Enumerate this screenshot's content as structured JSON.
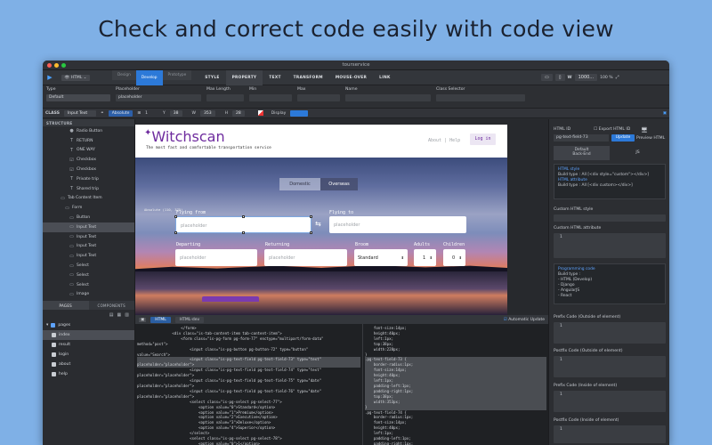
{
  "headline": "Check and correct code easily with code view",
  "window": {
    "title": "tourservice",
    "colors": {
      "close": "#fe5f57",
      "minimize": "#febc2e",
      "zoom": "#28c840",
      "accent": "#2c79d8"
    }
  },
  "toolbar": {
    "play_icon": "play-icon",
    "mode": "HTML",
    "segments": [
      "Design",
      "Develop",
      "Prototype"
    ],
    "active_segment": "Develop",
    "tabs": [
      "STYLE",
      "PROPERTY",
      "TEXT",
      "TRANSFORM",
      "MOUSE-OVER",
      "LINK"
    ],
    "w_label": "W",
    "w_value": "1000...",
    "zoom": "100 %"
  },
  "properties": {
    "type_label": "Type",
    "type_value": "Default",
    "placeholder_label": "Placeholder",
    "placeholder_value": "placeholder",
    "maxlength_label": "Max Length",
    "min_label": "Min",
    "max_label": "Max",
    "name_label": "Name",
    "class_selector_label": "Class Selector"
  },
  "classrow": {
    "class_label": "CLASS",
    "class_value": "Input Text",
    "position_value": "Absolute",
    "x_value": "1",
    "y_label": "Y",
    "y_value": "38",
    "w_label": "W",
    "w_value": "353",
    "h_label": "H",
    "h_value": "28",
    "display_label": "Display"
  },
  "structure": {
    "header": "STRUCTURE",
    "items": [
      {
        "label": "Radio Button",
        "glyph": "●",
        "indent": 30
      },
      {
        "label": "RETURN",
        "glyph": "T",
        "indent": 30
      },
      {
        "label": "ONE WAY",
        "glyph": "T",
        "indent": 30
      },
      {
        "label": "Checkbox",
        "glyph": "☑",
        "indent": 30
      },
      {
        "label": "Checkbox",
        "glyph": "☑",
        "indent": 30
      },
      {
        "label": "Private trip",
        "glyph": "T",
        "indent": 30
      },
      {
        "label": "Shared trip",
        "glyph": "T",
        "indent": 30
      },
      {
        "label": "Tab Content Item",
        "glyph": "▭",
        "indent": 20
      },
      {
        "label": "Form",
        "glyph": "▭",
        "indent": 25
      },
      {
        "label": "Button",
        "glyph": "▭",
        "indent": 30
      },
      {
        "label": "Input Text",
        "glyph": "▭",
        "indent": 30,
        "selected": true
      },
      {
        "label": "Input Text",
        "glyph": "▭",
        "indent": 30
      },
      {
        "label": "Input Text",
        "glyph": "▭",
        "indent": 30
      },
      {
        "label": "Input Text",
        "glyph": "▭",
        "indent": 30
      },
      {
        "label": "Select",
        "glyph": "▭",
        "indent": 30
      },
      {
        "label": "Select",
        "glyph": "▭",
        "indent": 30
      },
      {
        "label": "Select",
        "glyph": "▭",
        "indent": 30
      },
      {
        "label": "Image",
        "glyph": "▭",
        "indent": 30
      }
    ]
  },
  "pages_panel": {
    "tabs": [
      "PAGES",
      "COMPONENTS"
    ],
    "folder": "pages",
    "items": [
      "index",
      "result",
      "login",
      "about",
      "help"
    ]
  },
  "site": {
    "logo": "Witchscan",
    "tagline": "The most fast and comfortable transportation service",
    "nav_about": "About",
    "nav_sep": "|",
    "nav_help": "Help",
    "login": "Log in",
    "tabs": [
      "Domestic",
      "Overseas"
    ],
    "size_badge": "Absolute (110, 375)",
    "flying_from": "Flying from",
    "flying_to": "Flying to",
    "departing": "Departing",
    "returning": "Returning",
    "broom": "Broom",
    "adults": "Adults",
    "children": "Children",
    "placeholder": "placeholder",
    "broom_value": "Standard",
    "adults_value": "1",
    "children_value": "0",
    "swap_icon": "swap-arrows-icon"
  },
  "code_view": {
    "tabs": [
      "HTML",
      "HTML-dev"
    ],
    "automatic_update": "Automatic Update",
    "html_lines": [
      "                    </form>",
      "                <div class=\"is-tab-content-item tab-content-item\">",
      "                    <form class=\"is-pg-form pg-form-77\" enctype=\"multipart/form-data\"",
      "method=\"post\">",
      "                        <input class=\"is-pg-button pg-button-72\" type=\"button\"",
      "value=\"Search\">",
      "                        <input class=\"is-pg-text-field pg-text-field-73\" type=\"text\"",
      "placeholder=\"placeholder\">",
      "                        <input class=\"is-pg-text-field pg-text-field-74\" type=\"text\"",
      "placeholder=\"placeholder\">",
      "                        <input class=\"is-pg-text-field pg-text-field-75\" type=\"date\"",
      "placeholder=\"placeholder\">",
      "                        <input class=\"is-pg-text-field pg-text-field-76\" type=\"date\"",
      "placeholder=\"placeholder\">",
      "                        <select class=\"is-pg-select pg-select-77\">",
      "                            <option value=\"0\">Standard</option>",
      "                            <option value=\"1\">Premium</option>",
      "                            <option value=\"2\">Executive</option>",
      "                            <option value=\"3\">Deluxe</option>",
      "                            <option value=\"4\">Superior</option>",
      "                        </select>",
      "                        <select class=\"is-pg-select pg-select-78\">",
      "                            <option value=\"0\">1</option>",
      "                            <option value=\"1\">2</option>"
    ],
    "html_highlight": [
      6,
      7
    ],
    "css_lines": [
      "    font-size:14px;",
      "    height:40px;",
      "    left:1px;",
      "    top:38px;",
      "    width:228px;",
      "}",
      ".pg-text-field-73 {",
      "    border-radius:1px;",
      "    font-size:14px;",
      "    height:40px;",
      "    left:1px;",
      "    padding-left:1px;",
      "    padding-right:1px;",
      "    top:38px;",
      "    width:353px;",
      "}",
      ".pg-text-field-74 {",
      "    border-radius:1px;",
      "    font-size:14px;",
      "    height:40px;",
      "    left:1px;",
      "    padding-left:1px;",
      "    padding-right:1px;",
      "    top:38px;"
    ],
    "css_highlight": [
      6,
      7,
      8,
      9,
      10,
      11,
      12,
      13,
      14,
      15
    ]
  },
  "right_panel": {
    "html_id_label": "HTML ID",
    "export_label": "Export HTML ID",
    "html_id_value": "pg-text-field-73",
    "update_button": "Update",
    "preview_label": "Preview HTML",
    "tab_default": "Default\nBack-End",
    "tab_js": "JS",
    "html_style_title": "HTML style",
    "html_style_build": "Build type : All [<div style=\"custom\"></div>]",
    "html_attr_title": "HTML attribute",
    "html_attr_build": "Build type : All [<div custom></div>]",
    "custom_style_label": "Custom HTML style",
    "custom_attr_label": "Custom HTML attribute",
    "line_no": "1",
    "programming_title": "Programming code",
    "programming_lines": [
      "Build type :",
      "- HTML (Develop)",
      "- Django",
      "- AngularJS",
      "- React"
    ],
    "prefix_outside": "Prefix Code (Outside of element)",
    "postfix_outside": "Postfix Code (Outside of element)",
    "prefix_inside": "Prefix Code (Inside of element)",
    "postfix_inside": "Postfix Code (Inside of element)"
  }
}
